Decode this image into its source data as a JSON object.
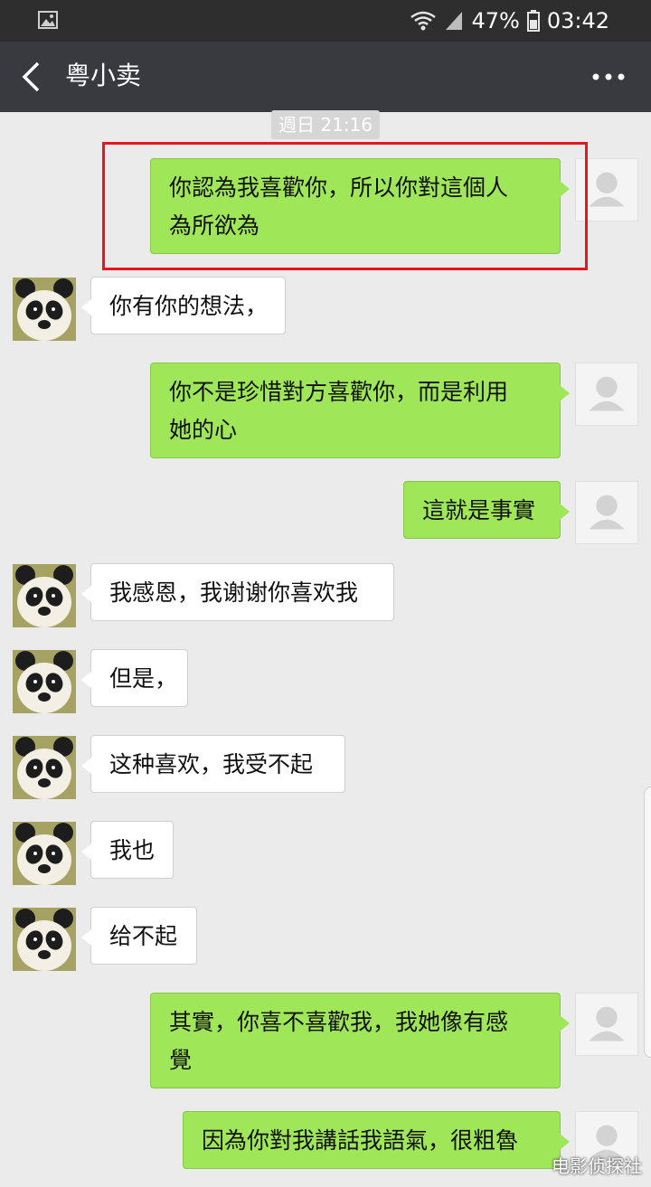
{
  "status_bar": {
    "battery": "47%",
    "time": "03:42"
  },
  "nav": {
    "title": "粤小卖"
  },
  "timestamp": "週日 21:16",
  "messages": [
    {
      "from": "self",
      "lines": [
        "你認為我喜歡你，所以你對這個人",
        "為所欲為"
      ]
    },
    {
      "from": "other",
      "lines": [
        "你有你的想法，"
      ]
    },
    {
      "from": "self",
      "lines": [
        "你不是珍惜對方喜歡你，而是利用",
        "她的心"
      ]
    },
    {
      "from": "self",
      "lines": [
        "這就是事實"
      ]
    },
    {
      "from": "other",
      "lines": [
        "我感恩，我谢谢你喜欢我"
      ]
    },
    {
      "from": "other",
      "lines": [
        "但是，"
      ]
    },
    {
      "from": "other",
      "lines": [
        "这种喜欢，我受不起"
      ]
    },
    {
      "from": "other",
      "lines": [
        "我也"
      ]
    },
    {
      "from": "other",
      "lines": [
        "给不起"
      ]
    },
    {
      "from": "self",
      "lines": [
        "其實，你喜不喜歡我，我她像有感",
        "覺"
      ]
    },
    {
      "from": "self",
      "lines": [
        "因為你對我講話我語氣，很粗魯"
      ]
    }
  ],
  "colors": {
    "self_bubble": "#9fe658",
    "other_bubble": "#ffffff",
    "highlight": "#e8161c",
    "nav_bar": "#393a3f"
  },
  "watermark": "电影侦探社"
}
